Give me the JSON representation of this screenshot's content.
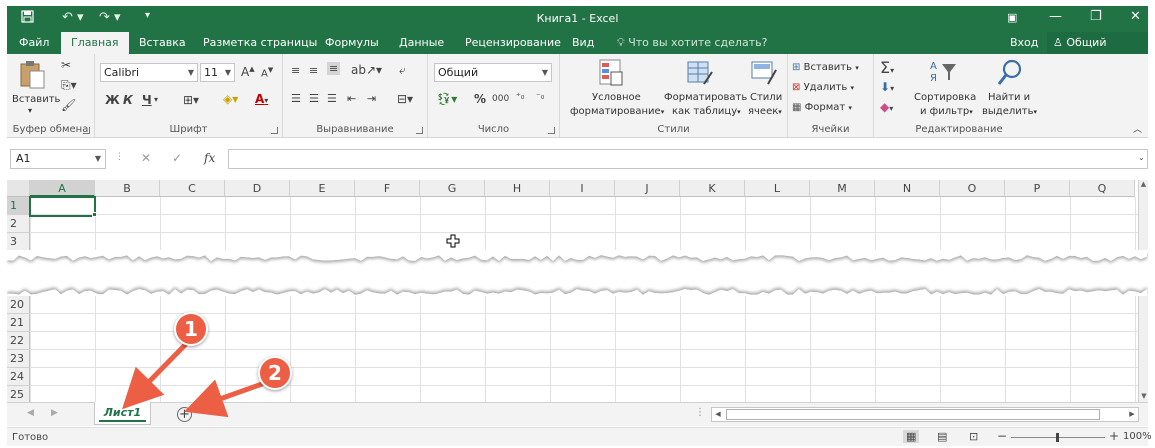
{
  "window": {
    "title": "Книга1 - Excel",
    "minimize_glyph": "—",
    "restore_glyph": "❐",
    "close_glyph": "✕",
    "ribbon_display_glyph": "▣"
  },
  "quick_access": {
    "save_icon": "save-icon",
    "undo_icon": "undo-icon",
    "redo_icon": "redo-icon"
  },
  "tabs": [
    {
      "label": "Файл"
    },
    {
      "label": "Главная"
    },
    {
      "label": "Вставка"
    },
    {
      "label": "Разметка страницы"
    },
    {
      "label": "Формулы"
    },
    {
      "label": "Данные"
    },
    {
      "label": "Рецензирование"
    },
    {
      "label": "Вид"
    }
  ],
  "active_tab": "Главная",
  "tell_me": "Что вы хотите сделать?",
  "sign_in": "Вход",
  "share": "Общий доступ",
  "ribbon": {
    "clipboard": {
      "paste": "Вставить",
      "label": "Буфер обмена"
    },
    "font": {
      "family": "Calibri",
      "size": "11",
      "bold": "Ж",
      "italic": "К",
      "underline": "Ч",
      "grow": "A",
      "shrink": "A",
      "font_color": "A",
      "label": "Шрифт"
    },
    "alignment": {
      "label": "Выравнивание"
    },
    "number": {
      "format": "Общий",
      "percent": "%",
      "thousands": "000",
      "label": "Число"
    },
    "styles": {
      "conditional_line1": "Условное",
      "conditional_line2": "форматирование",
      "table_line1": "Форматировать",
      "table_line2": "как таблицу",
      "cell_styles_line1": "Стили",
      "cell_styles_line2": "ячеек",
      "label": "Стили"
    },
    "cells": {
      "insert": "Вставить",
      "delete": "Удалить",
      "format": "Формат",
      "label": "Ячейки"
    },
    "editing": {
      "sort_line1": "Сортировка",
      "sort_line2": "и фильтр",
      "find_line1": "Найти и",
      "find_line2": "выделить",
      "label": "Редактирование"
    }
  },
  "formula_bar": {
    "name_box": "A1",
    "fx": "fx",
    "cancel": "✕",
    "enter": "✓",
    "value": ""
  },
  "columns": [
    "A",
    "B",
    "C",
    "D",
    "E",
    "F",
    "G",
    "H",
    "I",
    "J",
    "K",
    "L",
    "M",
    "N",
    "O",
    "P",
    "Q"
  ],
  "selected_column": "A",
  "rows_top": [
    "1",
    "2",
    "3"
  ],
  "rows_bottom": [
    "20",
    "21",
    "22",
    "23",
    "24",
    "25"
  ],
  "selected_row": "1",
  "sheets": [
    {
      "name": "Лист1",
      "active": true
    }
  ],
  "add_sheet_glyph": "+",
  "status": {
    "ready": "Готово",
    "zoom": "100%"
  },
  "callouts": [
    "1",
    "2"
  ],
  "colors": {
    "accent": "#217346",
    "callout": "#ec5f44"
  }
}
